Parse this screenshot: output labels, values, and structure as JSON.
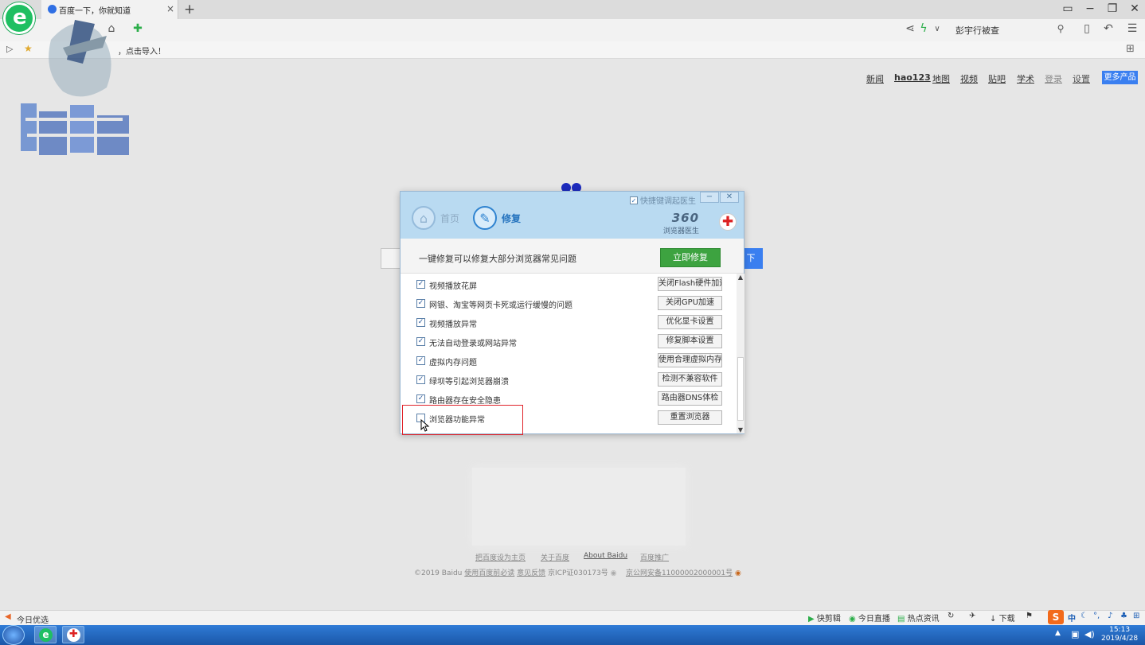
{
  "browser": {
    "tab_title": "百度一下，你就知道",
    "tab_close": "×",
    "new_tab": "+",
    "window_controls": [
      "−",
      "❐",
      "✕"
    ],
    "address_right_text": "彭宇行被查",
    "bookmark_bar_text": "，点击导入！"
  },
  "baidu_nav": {
    "links": [
      "新闻",
      "hao123",
      "地图",
      "视频",
      "贴吧",
      "学术",
      "登录",
      "设置"
    ],
    "more_products": "更多产品",
    "search_button_partial": "下"
  },
  "dialog": {
    "hotkey_checkbox": "快捷键调起医生",
    "tabs": [
      "首页",
      "修复"
    ],
    "brand_number": "360",
    "brand_name": "浏览器医生",
    "subtitle": "一键修复可以修复大部分浏览器常见问题",
    "fix_button": "立即修复",
    "rows": [
      {
        "label": "视频播放花屏",
        "action": "关闭Flash硬件加速",
        "checked": true
      },
      {
        "label": "网银、淘宝等网页卡死或运行缓慢的问题",
        "action": "关闭GPU加速",
        "checked": true
      },
      {
        "label": "视频播放异常",
        "action": "优化显卡设置",
        "checked": true
      },
      {
        "label": "无法自动登录或网站异常",
        "action": "修复脚本设置",
        "checked": true
      },
      {
        "label": "虚拟内存问题",
        "action": "使用合理虚拟内存",
        "checked": true
      },
      {
        "label": "绿坝等引起浏览器崩溃",
        "action": "检测不兼容软件",
        "checked": true
      },
      {
        "label": "路由器存在安全隐患",
        "action": "路由器DNS体检",
        "checked": true
      },
      {
        "label": "浏览器功能异常",
        "action": "重置浏览器",
        "checked": false
      }
    ]
  },
  "footer": {
    "links": [
      "把百度设为主页",
      "关于百度",
      "About  Baidu",
      "百度推广"
    ],
    "copyright": "©2019 Baidu",
    "terms": "使用百度前必读",
    "feedback": "意见反馈",
    "icp": "京ICP证030173号",
    "police": "京公网安备11000002000001号"
  },
  "statusbar": {
    "left": "今日优选",
    "items": [
      "快剪辑",
      "今日直播",
      "热点资讯",
      "下载"
    ]
  },
  "taskbar": {
    "time": "15:13",
    "date": "2019/4/28",
    "ime": "中"
  },
  "colors": {
    "accent_blue": "#3a7ff0",
    "dialog_header": "#b9daf1",
    "fix_green": "#3da340",
    "highlight_red": "#e0242b",
    "logo_green": "#1fbf62"
  }
}
